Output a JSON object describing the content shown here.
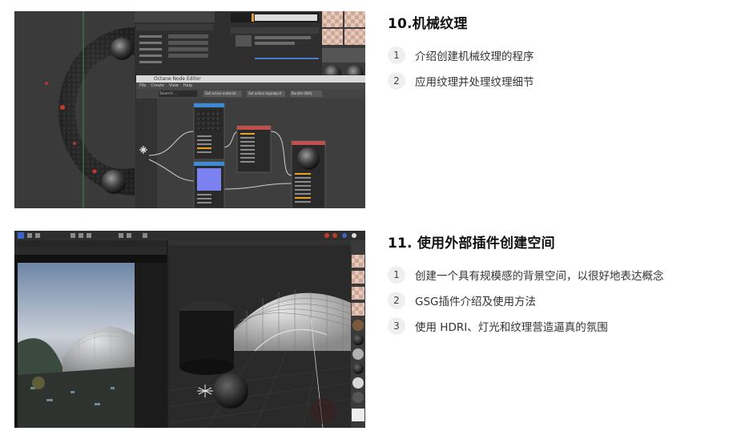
{
  "sections": [
    {
      "title": "10.机械纹理",
      "items": [
        {
          "num": "1",
          "text": "介绍创建机械纹理的程序"
        },
        {
          "num": "2",
          "text": "应用纹理并处理纹理细节"
        }
      ]
    },
    {
      "title": "11. 使用外部插件创建空间",
      "items": [
        {
          "num": "1",
          "text": "创建一个具有规模感的背景空间，以很好地表达概念"
        },
        {
          "num": "2",
          "text": "GSG插件介绍及使用方法"
        },
        {
          "num": "3",
          "text": "使用 HDRI、灯光和纹理营造逼真的氛围"
        }
      ]
    }
  ],
  "screenshot1": {
    "node_editor_title": "Octane Node Editor",
    "menu": [
      "File",
      "Create",
      "View",
      "Help"
    ],
    "toolbar": [
      "Get active material",
      "Set active tag/object",
      "Bundle (N/A)"
    ],
    "search_placeholder": "Search..."
  },
  "colors": {
    "dark_bg": "#2b2b2b",
    "node_header_blue": "#3d8ad8",
    "node_header_red": "#c0504d",
    "badge_bg": "#efefef"
  }
}
